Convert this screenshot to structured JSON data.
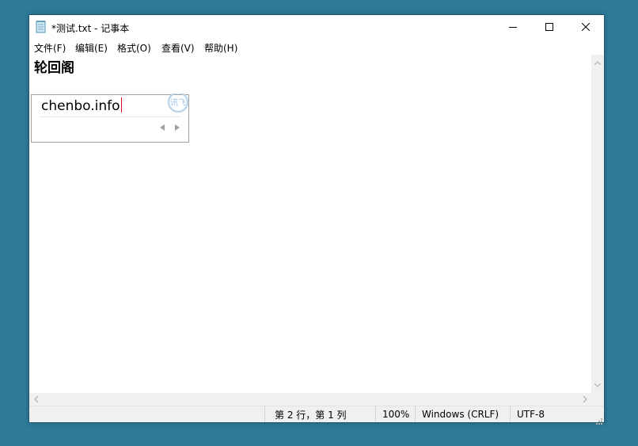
{
  "window": {
    "title": "*测试.txt - 记事本",
    "icon": "notepad-icon"
  },
  "caption": {
    "minimize_icon": "minimize-icon",
    "maximize_icon": "maximize-icon",
    "close_icon": "close-icon"
  },
  "menu": {
    "file": "文件(F)",
    "edit": "编辑(E)",
    "format": "格式(O)",
    "view": "查看(V)",
    "help": "帮助(H)"
  },
  "editor": {
    "line1": "轮回阁"
  },
  "ime": {
    "composition": "chenbo.info",
    "logo_text": "讯飞",
    "logo_icon": "ime-logo-icon",
    "prev_icon": "prev-page-icon",
    "next_icon": "next-page-icon"
  },
  "status": {
    "position": "第 2 行，第 1 列",
    "zoom": "100%",
    "line_ending": "Windows (CRLF)",
    "encoding": "UTF-8"
  },
  "colors": {
    "desktop": "#2e7b99",
    "caret": "#e0001b",
    "statusbar": "#f0f0f0"
  }
}
